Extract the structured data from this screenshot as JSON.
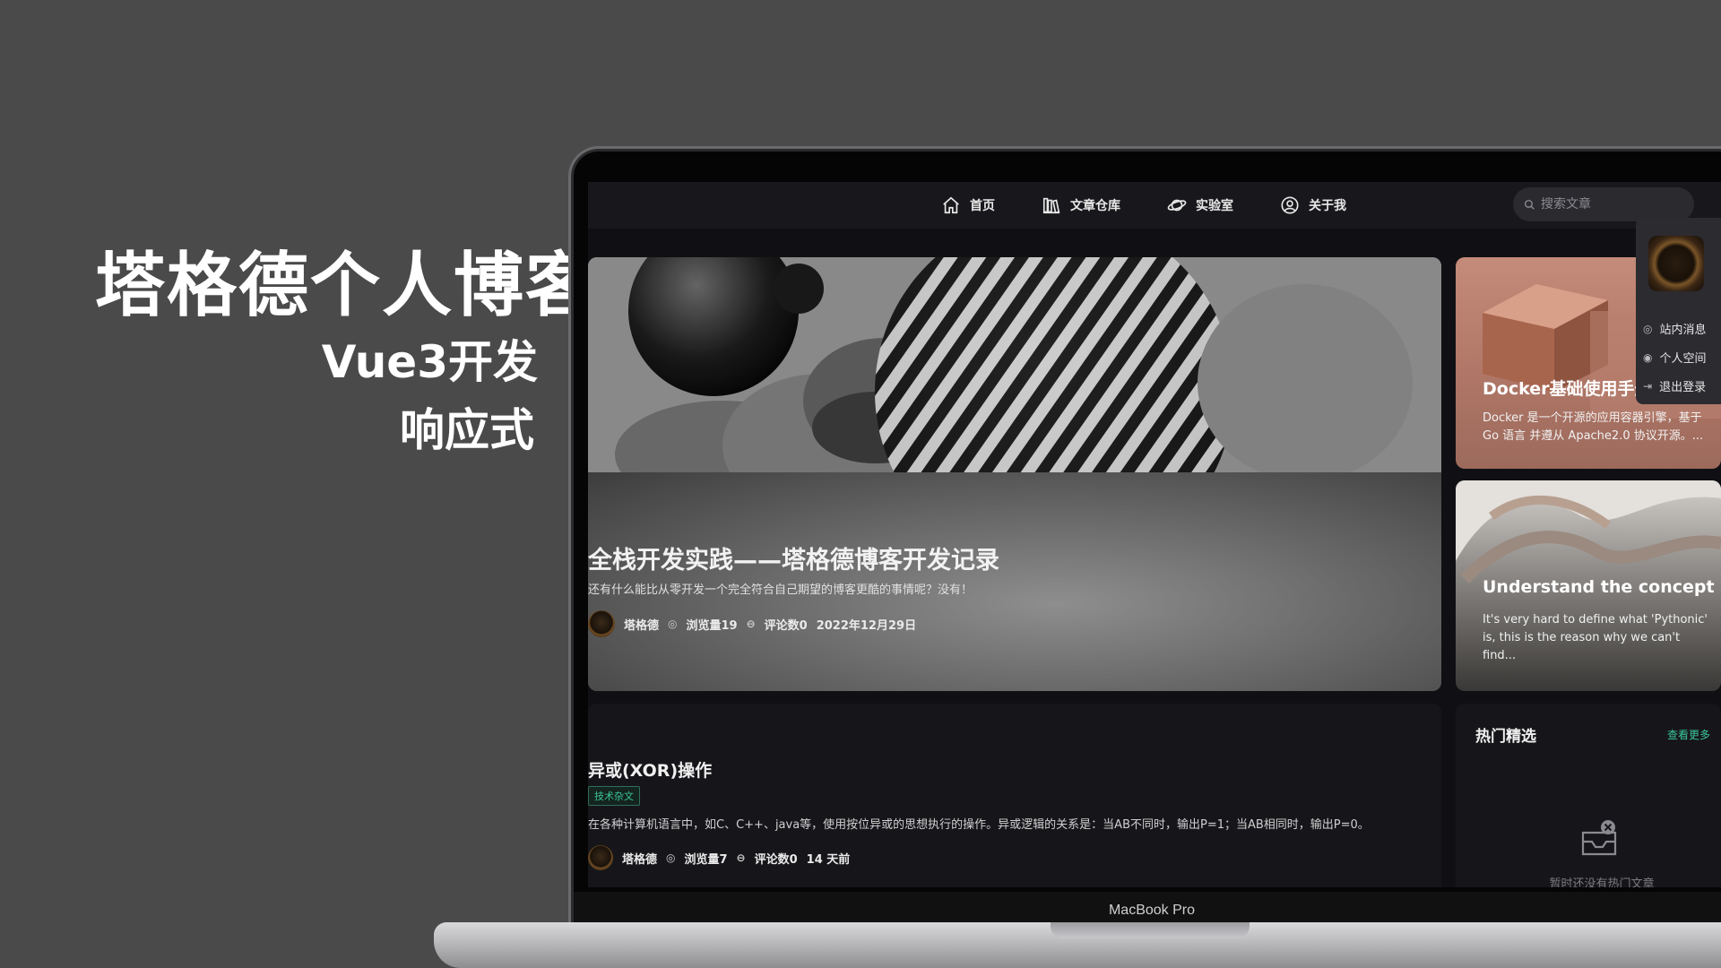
{
  "hero": {
    "title": "塔格德个人博客",
    "subtitle1": "Vue3开发",
    "subtitle2": "响应式"
  },
  "device_label": "MacBook Pro",
  "nav": {
    "items": [
      {
        "label": "首页",
        "icon": "home-icon"
      },
      {
        "label": "文章仓库",
        "icon": "library-icon"
      },
      {
        "label": "实验室",
        "icon": "planet-icon"
      },
      {
        "label": "关于我",
        "icon": "user-icon"
      }
    ],
    "search_placeholder": "搜索文章"
  },
  "feature": {
    "title": "全栈开发实践——塔格德博客开发记录",
    "desc": "还有什么能比从零开发一个完全符合自己期望的博客更酷的事情呢？没有！",
    "author": "塔格德",
    "views": "浏览量19",
    "comments": "评论数0",
    "date": "2022年12月29日"
  },
  "side_cards": [
    {
      "title": "Docker基础使用手册",
      "desc": "Docker 是一个开源的应用容器引擎，基于 Go 语言 并遵从 Apache2.0 协议开源。..."
    },
    {
      "title": "Understand the concept o...",
      "desc": "It's very hard to define what 'Pythonic' is, this is the reason why we can't find..."
    }
  ],
  "dropdown": {
    "items": [
      {
        "label": "站内消息",
        "icon": "message-icon"
      },
      {
        "label": "个人空间",
        "icon": "profile-icon"
      },
      {
        "label": "退出登录",
        "icon": "logout-icon"
      }
    ]
  },
  "article": {
    "title": "异或(XOR)操作",
    "tag": "技术杂文",
    "desc": "在各种计算机语言中，如C、C++、java等，使用按位异或的思想执行的操作。异或逻辑的关系是：当AB不同时，输出P=1；当AB相同时，输出P=0。",
    "author": "塔格德",
    "views": "浏览量7",
    "comments": "评论数0",
    "time": "14 天前"
  },
  "hot": {
    "title": "热门精选",
    "more": "查看更多",
    "empty": "暂时还没有热门文章"
  },
  "colors": {
    "accent": "#3cc59a",
    "background": "#4a4a4a",
    "screen_bg": "#101014"
  }
}
